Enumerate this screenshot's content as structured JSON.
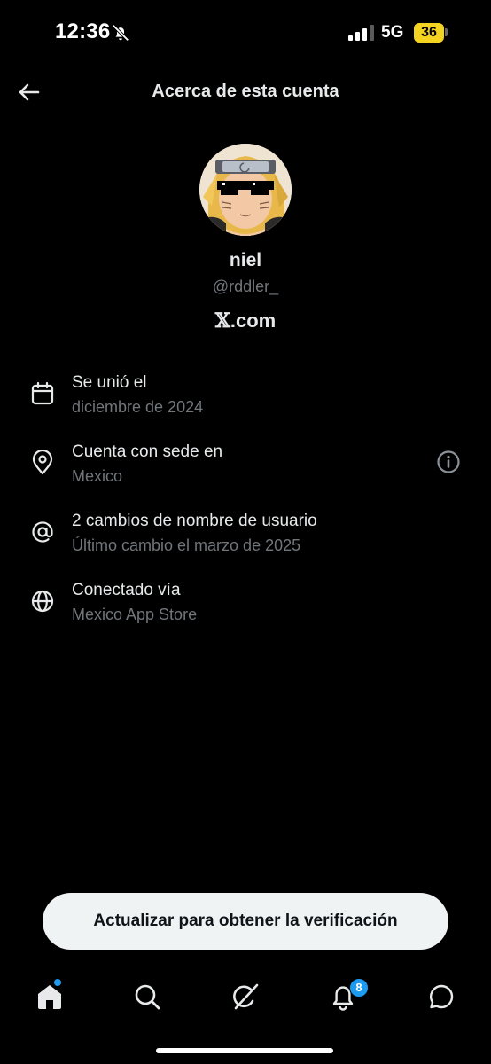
{
  "status_bar": {
    "time": "12:36",
    "network": "5G",
    "battery": "36",
    "icons": [
      "bell-off-icon",
      "signal-icon"
    ]
  },
  "header": {
    "title": "Acerca de esta cuenta",
    "back_icon": "arrow-left-icon"
  },
  "profile": {
    "name": "niel",
    "handle": "@rddler_",
    "site": ".com",
    "site_logo_letter": "𝕏"
  },
  "info": [
    {
      "icon": "calendar-icon",
      "title": "Se unió el",
      "subtitle": "diciembre de 2024"
    },
    {
      "icon": "location-pin-icon",
      "title": "Cuenta con sede en",
      "subtitle": "Mexico",
      "action_icon": "info-circle-icon"
    },
    {
      "icon": "at-sign-icon",
      "title": "2 cambios de nombre de usuario",
      "subtitle": "Último cambio el marzo de 2025"
    },
    {
      "icon": "globe-icon",
      "title": "Conectado vía",
      "subtitle": "Mexico App Store"
    }
  ],
  "cta": {
    "label": "Actualizar para obtener la verificación"
  },
  "tab_bar": {
    "tabs": [
      "home-icon",
      "search-icon",
      "grok-icon",
      "bell-icon",
      "messages-icon"
    ],
    "notifications_count": "8"
  },
  "colors": {
    "background": "#000000",
    "primary_text": "#e7e9ea",
    "secondary_text": "#71767b",
    "accent": "#1d9bf0",
    "battery": "#f4d321"
  }
}
